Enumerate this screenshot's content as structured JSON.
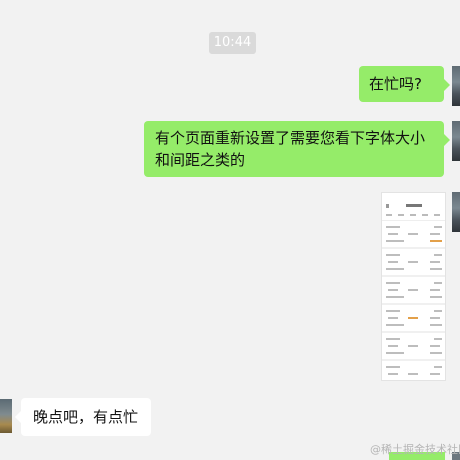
{
  "chat": {
    "timestamp": "10:44",
    "messages": [
      {
        "sender": "me",
        "text": "在忙吗?"
      },
      {
        "sender": "me",
        "text": "有个页面重新设置了需要您看下字体大小和间距之类的"
      },
      {
        "sender": "me",
        "type": "image",
        "description": "手机页面截图"
      },
      {
        "sender": "other",
        "text": "晚点吧，有点忙"
      }
    ]
  },
  "watermark": "@稀土掘金技术社区",
  "colors": {
    "background": "#f2f2f2",
    "my_bubble": "#95ec69",
    "other_bubble": "#ffffff",
    "timestamp_bg": "#dadada"
  }
}
